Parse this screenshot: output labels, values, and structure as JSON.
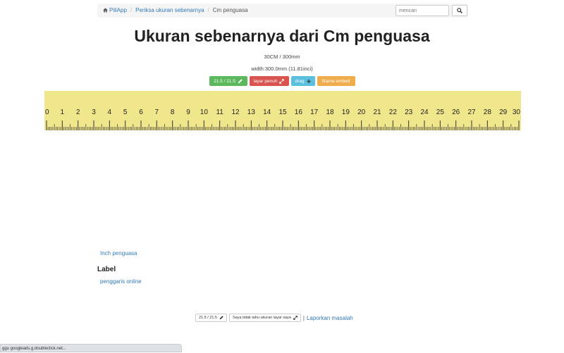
{
  "breadcrumb": {
    "home": "PiliApp",
    "section": "Periksa ukuran sebenarnya",
    "current": "Cm penguasa"
  },
  "search": {
    "placeholder": "mencari"
  },
  "page": {
    "title": "Ukuran sebenarnya dari Cm penguasa",
    "length_info": "30CM / 300mm",
    "width_info": "width:300.0mm (11.81inci)"
  },
  "buttons": {
    "size": "21.5 / 21.5",
    "fullscreen": "layar penuh",
    "drag": "drag",
    "embed": "iframe embed"
  },
  "ruler": {
    "labels": [
      "0",
      "1",
      "2",
      "3",
      "4",
      "5",
      "6",
      "7",
      "8",
      "9",
      "10",
      "11",
      "12",
      "13",
      "14",
      "15",
      "16",
      "17",
      "18",
      "19",
      "20",
      "21",
      "22",
      "23",
      "24",
      "25",
      "26",
      "27",
      "28",
      "29",
      "30"
    ],
    "color": "#f0e68c"
  },
  "links": {
    "inch": "Inch penguasa",
    "label_heading": "Label",
    "online": "penggaris online"
  },
  "footer": {
    "size": "21.5 / 21.5",
    "unknown": "Saya tidak tahu ukuran layar saya",
    "report": "Laporkan masalah",
    "separator": "|"
  },
  "status": {
    "text": "ggu googleads.g.doubleclick.net..."
  }
}
